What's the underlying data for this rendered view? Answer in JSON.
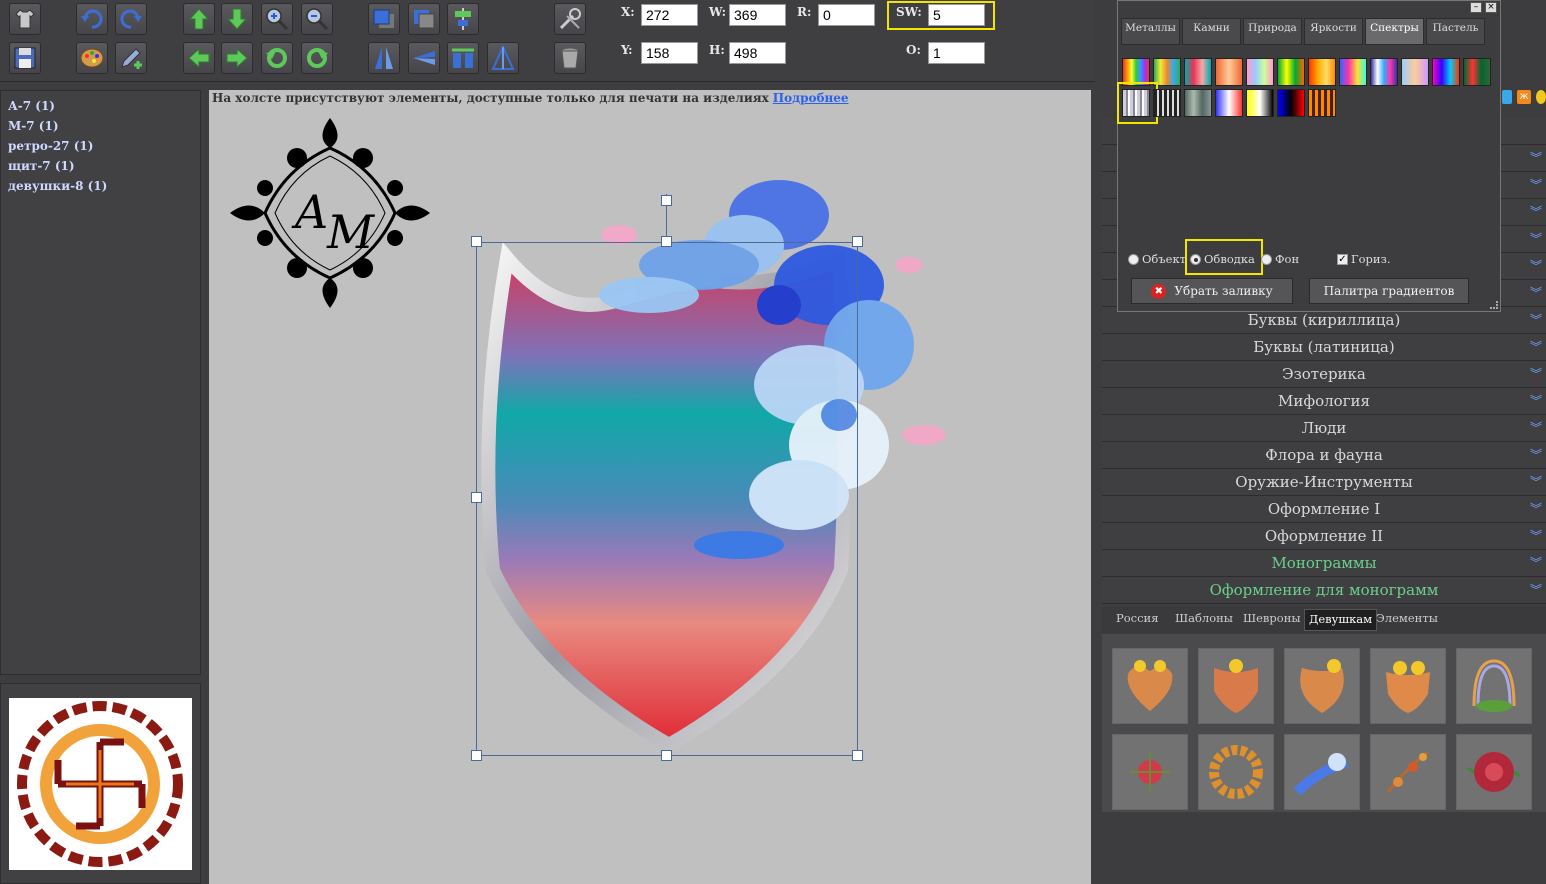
{
  "toolbar": {
    "x_label": "X:",
    "x_value": "272",
    "w_label": "W:",
    "w_value": "369",
    "r_label": "R:",
    "r_value": "0",
    "sw_label": "SW:",
    "sw_value": "5",
    "y_label": "Y:",
    "y_value": "158",
    "h_label": "H:",
    "h_value": "498",
    "o_label": "O:",
    "o_value": "1",
    "icons": [
      "tshirt-icon",
      "undo-icon",
      "redo-icon",
      "arrow-up-icon",
      "arrow-down-icon",
      "zoom-in-icon",
      "zoom-out-icon",
      "bring-front-icon",
      "send-back-icon",
      "align-center-icon",
      "tools-icon",
      "save-icon",
      "palette-icon",
      "edit-icon",
      "arrow-left-icon",
      "arrow-right-icon",
      "rotate-left-icon",
      "rotate-right-icon",
      "flip-vertical-icon",
      "flip-horizontal-icon",
      "distribute-icon",
      "mirror-icon",
      "trash-icon"
    ]
  },
  "layers": [
    "А-7 (1)",
    "М-7 (1)",
    "ретро-27 (1)",
    "щит-7 (1)",
    "девушки-8 (1)"
  ],
  "canvas": {
    "notice": "На холсте присутствуют элементы, доступные только для печати на изделиях",
    "notice_link": "Подробнее"
  },
  "dialog": {
    "tabs": [
      "Металлы",
      "Камни",
      "Природа",
      "Яркости",
      "Спектры",
      "Пастель"
    ],
    "active_tab": "Спектры",
    "radio_object": "Объект",
    "radio_stroke": "Обводка",
    "radio_bg": "Фон",
    "checkbox_horiz": "Гориз.",
    "remove_fill": "Убрать заливку",
    "gradient_palette": "Палитра градиентов",
    "colors": {
      "highlight": "#f2e600",
      "panel": "#3d3d40"
    }
  },
  "categories": [
    "Буквы (кириллица)",
    "Буквы (латиница)",
    "Эзотерика",
    "Мифология",
    "Люди",
    "Флора и фауна",
    "Оружие-Инструменты",
    "Оформление I",
    "Оформление II",
    "Монограммы",
    "Оформление для монограмм"
  ],
  "subtabs": [
    "Россия",
    "Шаблоны",
    "Шевроны",
    "Девушкам",
    "Элементы"
  ],
  "active_subtab": "Девушкам"
}
